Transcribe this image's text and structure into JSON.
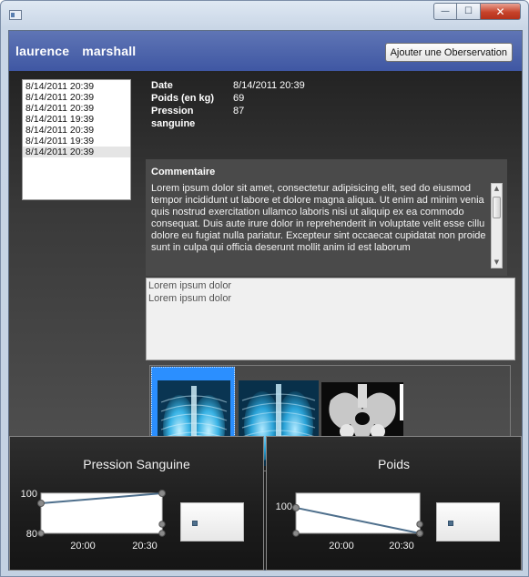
{
  "window": {
    "min_glyph": "—",
    "max_glyph": "☐",
    "close_glyph": "✕"
  },
  "header": {
    "first_name": "laurence",
    "last_name": "marshall",
    "add_button_label": "Ajouter une Oberservation"
  },
  "observations": {
    "dates": [
      "8/14/2011 20:39",
      "8/14/2011 20:39",
      "8/14/2011 20:39",
      "8/14/2011 19:39",
      "8/14/2011 20:39",
      "8/14/2011 19:39",
      "8/14/2011 20:39"
    ],
    "selected_index": 6
  },
  "details": {
    "date_label": "Date",
    "date_value": "8/14/2011 20:39",
    "weight_label": "Poids (en kg)",
    "weight_value": "69",
    "pressure_label": "Pression sanguine",
    "pressure_value": "87"
  },
  "comment": {
    "title": "Commentaire",
    "lines": [
      "Lorem ipsum dolor sit amet, consectetur adipisicing elit, sed do eiusmod",
      "tempor incididunt ut labore et dolore magna aliqua. Ut enim ad minim venia",
      "quis nostrud exercitation ullamco laboris nisi ut aliquip ex ea commodo",
      "consequat. Duis aute irure dolor in reprehenderit in voluptate velit esse cillu",
      "dolore eu fugiat nulla pariatur. Excepteur sint occaecat cupidatat non proide",
      "sunt in culpa qui officia deserunt mollit anim id est laborum"
    ],
    "scroll_up": "▲",
    "scroll_down": "▼"
  },
  "notes": {
    "lines": [
      "Lorem ipsum dolor",
      "Lorem ipsum dolor"
    ]
  },
  "gallery": {
    "images": [
      {
        "name": "chest-xray-1",
        "selected": true
      },
      {
        "name": "chest-xray-2",
        "selected": false
      },
      {
        "name": "pelvis-xray",
        "selected": false
      }
    ]
  },
  "colors": {
    "header_bg": "#4a62aa",
    "selection_blue": "#2b8fff",
    "series_line": "#4e6f8c"
  },
  "chart_data": [
    {
      "type": "line",
      "title": "Pression Sanguine",
      "x": [
        "19:39",
        "20:39"
      ],
      "values": [
        95,
        100
      ],
      "x_ticks": [
        "20:00",
        "20:30"
      ],
      "y_ticks": [
        "80",
        "100"
      ],
      "ylim": [
        80,
        100
      ],
      "legend": "right"
    },
    {
      "type": "line",
      "title": "Poids",
      "x": [
        "19:39",
        "20:39"
      ],
      "values": [
        98,
        69
      ],
      "x_ticks": [
        "20:00",
        "20:30"
      ],
      "y_ticks": [
        "100"
      ],
      "legend": "right"
    }
  ]
}
